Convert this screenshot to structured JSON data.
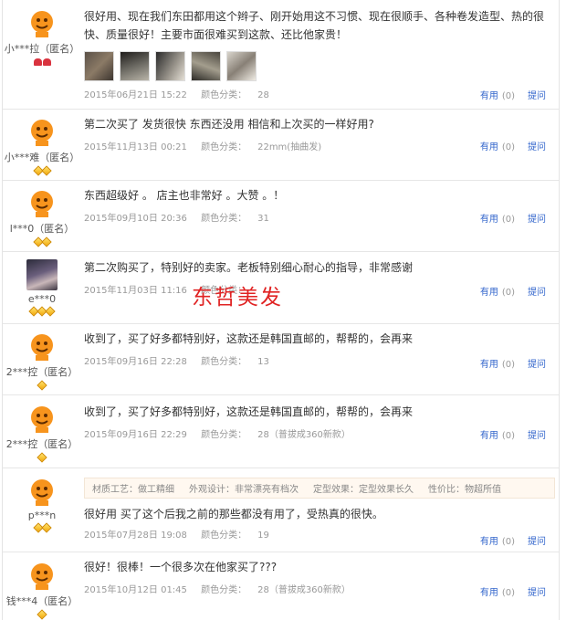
{
  "labels": {
    "color_category": "颜色分类：",
    "useful": "有用",
    "reply": "提问"
  },
  "watermark": "东哲美发",
  "reviews": [
    {
      "user": "小***拉（匿名）",
      "rank": "heart",
      "text": "很好用、现在我们东田都用这个辫子、刚开始用这不习惯、现在很顺手、各种卷发造型、热的很快、质量很好！主要市面很难买到这款、还比他家贵！",
      "photos": [
        "photo-1",
        "photo-2",
        "photo-3",
        "photo-4",
        "photo-5"
      ],
      "date": "2015年06月21日 15:22",
      "color": "28",
      "useful": "(0)"
    },
    {
      "user": "小***难（匿名）",
      "rank": "gem",
      "text": "第二次买了 发货很快 东西还没用 相信和上次买的一样好用?",
      "date": "2015年11月13日 00:21",
      "color": "22mm(抽曲发)",
      "useful": "(0)"
    },
    {
      "user": "l***0（匿名）",
      "rank": "gem",
      "text": "东西超级好 。 店主也非常好 。大赞 。！",
      "date": "2015年09月10日 20:36",
      "color": "31",
      "useful": "(0)"
    },
    {
      "user": "e***0",
      "rank": "gem3",
      "text": "第二次购买了，特别好的卖家。老板特别细心耐心的指导，非常感谢",
      "date": "2015年11月03日 11:16",
      "color": "",
      "useful": "(0)"
    },
    {
      "user": "2***控（匿名）",
      "rank": "gem1",
      "text": "收到了，买了好多都特别好，这款还是韩国直邮的，帮帮的，会再来",
      "date": "2015年09月16日 22:28",
      "color": "13",
      "useful": "(0)"
    },
    {
      "user": "2***控（匿名）",
      "rank": "gem1",
      "text": "收到了，买了好多都特别好，这款还是韩国直邮的，帮帮的，会再来",
      "date": "2015年09月16日 22:29",
      "color": "28（普拔成360新款）",
      "useful": "(0)"
    },
    {
      "user": "p***n",
      "rank": "gem",
      "tags": [
        "材质工艺：做工精细",
        "外观设计：非常漂亮有档次",
        "定型效果：定型效果长久",
        "性价比：物超所值"
      ],
      "text": "很好用 买了这个后我之前的那些都没有用了，受热真的很快。",
      "date": "2015年07月28日 19:08",
      "color": "19",
      "useful": "(0)"
    },
    {
      "user": "钱***4（匿名）",
      "rank": "gem1",
      "text": "很好！很棒！一个很多次在他家买了???",
      "date": "2015年10月12日 01:45",
      "color": "28（普拔成360新款）",
      "useful": "(0)"
    }
  ]
}
